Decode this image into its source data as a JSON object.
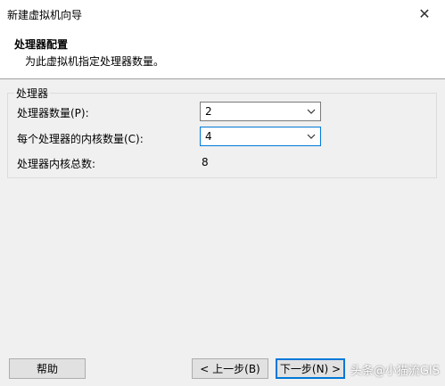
{
  "window": {
    "title": "新建虚拟机向导",
    "close_glyph": "✕"
  },
  "header": {
    "title": "处理器配置",
    "subtitle": "为此虚拟机指定处理器数量。"
  },
  "processors_group": {
    "legend": "处理器",
    "processor_count_label": "处理器数量(P):",
    "processor_count_value": "2",
    "cores_per_processor_label": "每个处理器的内核数量(C):",
    "cores_per_processor_value": "4",
    "total_cores_label": "处理器内核总数:",
    "total_cores_value": "8"
  },
  "footer": {
    "help_label": "帮助",
    "back_label": "< 上一步(B)",
    "next_label": "下一步(N) >",
    "watermark": "头条@小猫流GIS"
  },
  "colors": {
    "focus_accent": "#0078d7",
    "dialog_bg": "#f0f0f0"
  }
}
